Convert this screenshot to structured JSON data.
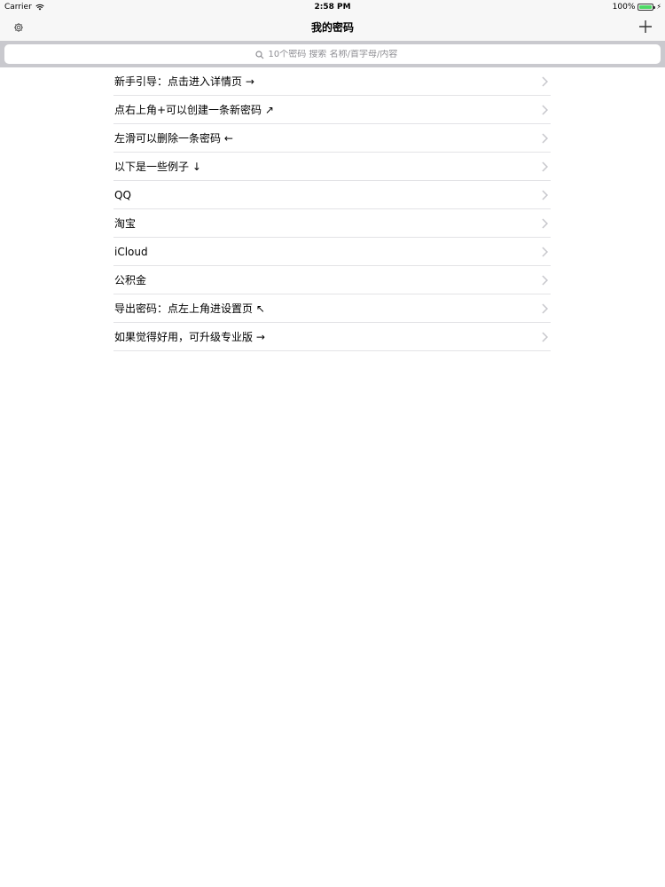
{
  "status_bar": {
    "carrier": "Carrier",
    "time": "2:58 PM",
    "battery": "100%"
  },
  "nav": {
    "title": "我的密码"
  },
  "search": {
    "placeholder": "10个密码 搜索 名称/首字母/内容"
  },
  "list": {
    "items": [
      {
        "label": "新手引导：点击进入详情页 →"
      },
      {
        "label": "点右上角+可以创建一条新密码 ↗"
      },
      {
        "label": "左滑可以删除一条密码 ←"
      },
      {
        "label": "以下是一些例子 ↓"
      },
      {
        "label": "QQ"
      },
      {
        "label": "淘宝"
      },
      {
        "label": "iCloud"
      },
      {
        "label": "公积金"
      },
      {
        "label": "导出密码：点左上角进设置页 ↖"
      },
      {
        "label": "如果觉得好用，可升级专业版 →"
      }
    ]
  },
  "colors": {
    "bar_background": "#f7f7f7",
    "search_background": "#c9c9ce",
    "separator": "#e3e3e6",
    "chevron": "#c7c7cc",
    "battery": "#4cd964"
  },
  "icons": [
    "wifi-icon",
    "battery-icon",
    "gear-icon",
    "plus-icon",
    "search-icon",
    "chevron-right-icon"
  ]
}
